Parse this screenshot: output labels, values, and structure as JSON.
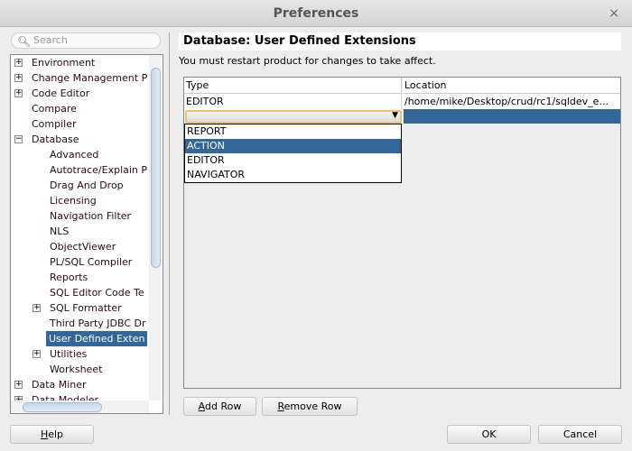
{
  "window": {
    "title": "Preferences",
    "close": "×"
  },
  "search": {
    "placeholder": "Search"
  },
  "tree": [
    {
      "label": "Environment",
      "level": 0,
      "expander": "+"
    },
    {
      "label": "Change Management P",
      "level": 0,
      "expander": "+"
    },
    {
      "label": "Code Editor",
      "level": 0,
      "expander": "+"
    },
    {
      "label": "Compare",
      "level": 0,
      "expander": ""
    },
    {
      "label": "Compiler",
      "level": 0,
      "expander": ""
    },
    {
      "label": "Database",
      "level": 0,
      "expander": "-"
    },
    {
      "label": "Advanced",
      "level": 1,
      "expander": ""
    },
    {
      "label": "Autotrace/Explain P",
      "level": 1,
      "expander": ""
    },
    {
      "label": "Drag And Drop",
      "level": 1,
      "expander": ""
    },
    {
      "label": "Licensing",
      "level": 1,
      "expander": ""
    },
    {
      "label": "Navigation Filter",
      "level": 1,
      "expander": ""
    },
    {
      "label": "NLS",
      "level": 1,
      "expander": ""
    },
    {
      "label": "ObjectViewer",
      "level": 1,
      "expander": ""
    },
    {
      "label": "PL/SQL Compiler",
      "level": 1,
      "expander": ""
    },
    {
      "label": "Reports",
      "level": 1,
      "expander": ""
    },
    {
      "label": "SQL Editor Code Te",
      "level": 1,
      "expander": ""
    },
    {
      "label": "SQL Formatter",
      "level": 1,
      "expander": "+"
    },
    {
      "label": "Third Party JDBC Dr",
      "level": 1,
      "expander": ""
    },
    {
      "label": "User Defined Exten",
      "level": 1,
      "expander": "",
      "selected": true
    },
    {
      "label": "Utilities",
      "level": 1,
      "expander": "+"
    },
    {
      "label": "Worksheet",
      "level": 1,
      "expander": ""
    },
    {
      "label": "Data Miner",
      "level": 0,
      "expander": "+"
    },
    {
      "label": "Data Modeler",
      "level": 0,
      "expander": "+"
    }
  ],
  "main": {
    "heading": "Database: User Defined Extensions",
    "notice": "You must restart product for changes to take affect.",
    "columns": [
      "Type",
      "Location"
    ],
    "rows": [
      {
        "type": "EDITOR",
        "location": "/home/mike/Desktop/crud/rc1/sqldev_e..."
      }
    ],
    "dropdown_options": [
      "REPORT",
      "ACTION",
      "EDITOR",
      "NAVIGATOR"
    ],
    "dropdown_highlighted": "ACTION",
    "add_row": {
      "mn": "A",
      "rest": "dd Row"
    },
    "remove_row": {
      "mn": "R",
      "rest": "emove Row"
    }
  },
  "footer": {
    "help": {
      "mn": "H",
      "rest": "elp"
    },
    "ok": "OK",
    "cancel": "Cancel"
  },
  "colors": {
    "selection": "#336699",
    "combo_focus": "#f0c070"
  }
}
